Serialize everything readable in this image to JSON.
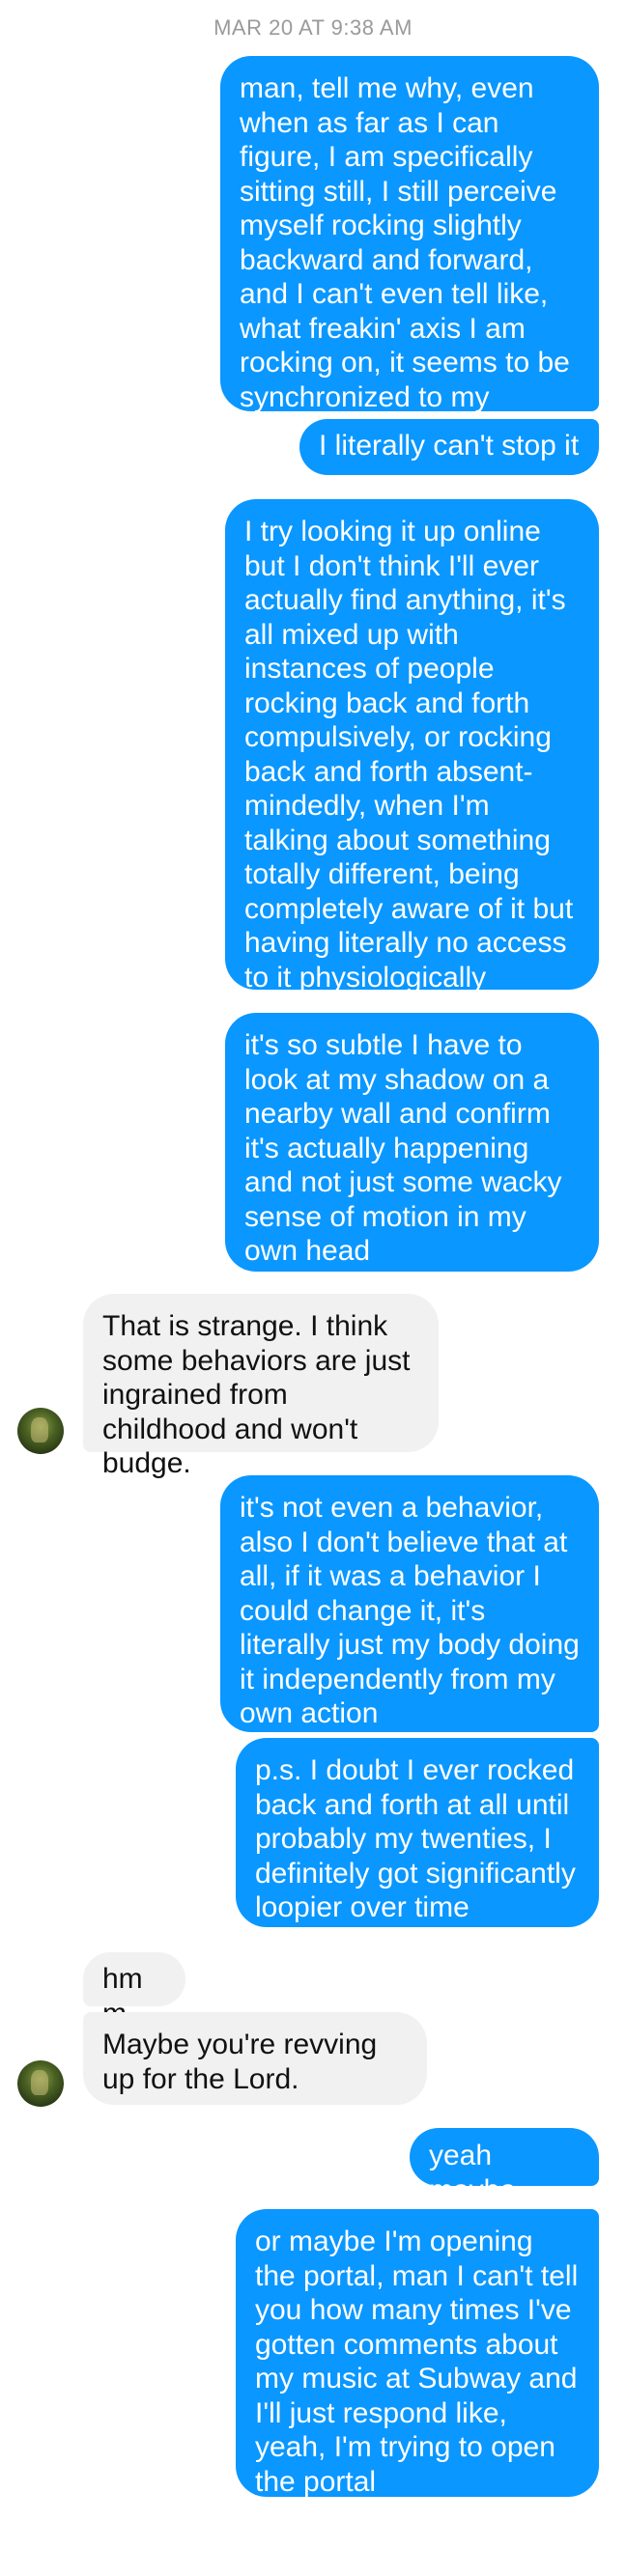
{
  "conversation": {
    "timestamp": "MAR 20 AT 9:38 AM",
    "messages": [
      {
        "from": "me",
        "text": "man, tell me why, even when as far as I can figure, I am specifically sitting still, I still perceive myself rocking slightly backward and forward, and I can't even tell like, what freakin' axis I am rocking on, it seems to be synchronized to my heartbeat"
      },
      {
        "from": "me",
        "text": "I literally can't stop it"
      },
      {
        "from": "me",
        "text": "I try looking it up online but I don't think I'll ever actually find anything, it's all mixed up with instances of people rocking back and forth compulsively, or rocking back and forth absent-mindedly, when I'm talking about something totally different, being completely aware of it but having literally no access to it physiologically"
      },
      {
        "from": "me",
        "text": "it's so subtle I have to look at my shadow on a nearby wall and confirm it's actually happening and not just some wacky sense of motion in my own head"
      },
      {
        "from": "them",
        "text": "That is strange. I think some behaviors are just ingrained from childhood and won't budge."
      },
      {
        "from": "me",
        "text": "it's not even a behavior, also I don't believe that at all, if it was a behavior I could change it, it's literally just my body doing it independently from my own action"
      },
      {
        "from": "me",
        "text": "p.s. I doubt I ever rocked back and forth at all until probably my twenties, I definitely got significantly loopier over time"
      },
      {
        "from": "them",
        "text": "hmm"
      },
      {
        "from": "them",
        "text": "Maybe you're revving up for the Lord."
      },
      {
        "from": "me",
        "text": "yeah maybe"
      },
      {
        "from": "me",
        "text": "or maybe I'm opening the portal, man I can't tell you how many times I've gotten comments about my music at Subway and I'll just respond like, yeah, I'm trying to open the portal"
      }
    ]
  },
  "colors": {
    "outgoing": "#0a97ff",
    "incoming": "#f1f1f1",
    "timestamp": "#9a9a9a"
  },
  "icons": {
    "avatar": "contact-avatar-icon"
  }
}
